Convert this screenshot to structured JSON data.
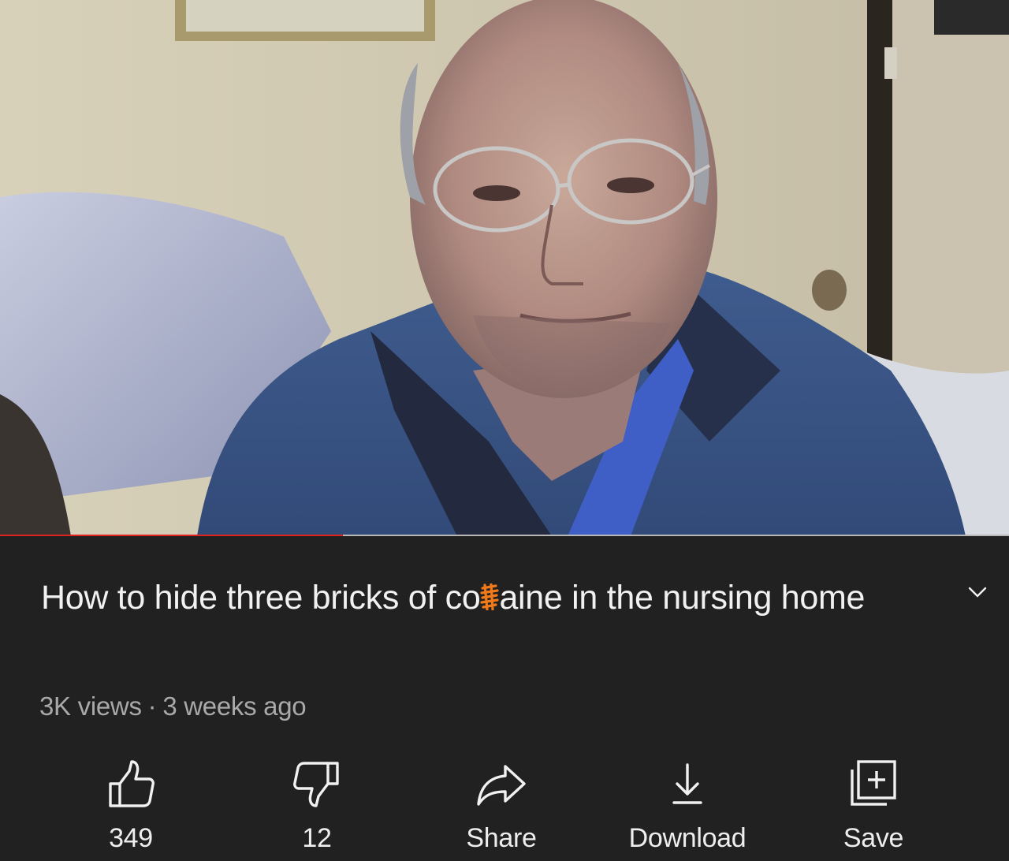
{
  "video": {
    "progress_fraction": 0.34,
    "progress_color": "#e1231f"
  },
  "details": {
    "title_before": "How to hide three bricks of co",
    "title_redacted_char": "c",
    "title_after": "aine in the nursing home",
    "views": "3K views",
    "separator": "·",
    "age": "3 weeks ago",
    "expand_icon": "chevron-down-icon"
  },
  "actions": [
    {
      "name": "like",
      "icon": "thumbs-up-icon",
      "label": "349"
    },
    {
      "name": "dislike",
      "icon": "thumbs-down-icon",
      "label": "12"
    },
    {
      "name": "share",
      "icon": "share-arrow-icon",
      "label": "Share"
    },
    {
      "name": "download",
      "icon": "download-icon",
      "label": "Download"
    },
    {
      "name": "save",
      "icon": "playlist-add-icon",
      "label": "Save"
    }
  ],
  "colors": {
    "background": "#212121",
    "text": "#f1f1f1",
    "meta": "#a9a9a9",
    "scribble": "#f07a1a"
  }
}
